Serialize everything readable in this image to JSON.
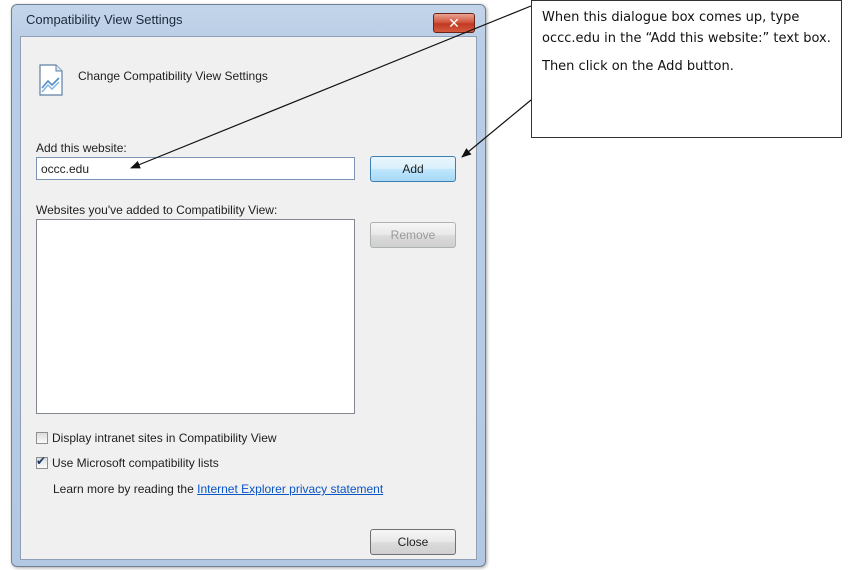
{
  "dialog": {
    "title": "Compatibility View Settings",
    "close_glyph": "✕",
    "header_icon": "compatibility-view-icon",
    "header_text": "Change Compatibility View Settings",
    "add_label": "Add this website:",
    "add_value": "occc.edu",
    "add_button": "Add",
    "list_label": "Websites you've added to Compatibility View:",
    "remove_button": "Remove",
    "checkbox_intranet": {
      "label": "Display intranet sites in Compatibility View",
      "checked": false
    },
    "checkbox_mslists": {
      "label": "Use Microsoft compatibility lists",
      "checked": true
    },
    "learn_more": "Learn more by reading the",
    "privacy_link": "Internet Explorer privacy statement",
    "close_button": "Close"
  },
  "annotation": {
    "line1": "When this dialogue box comes up, type occc.edu in the “Add this website:” text box.",
    "line2": "Then click on the Add button."
  },
  "colors": {
    "link": "#0a55c6",
    "title_bar": "#b9cde6",
    "close_button": "#c03a22"
  }
}
